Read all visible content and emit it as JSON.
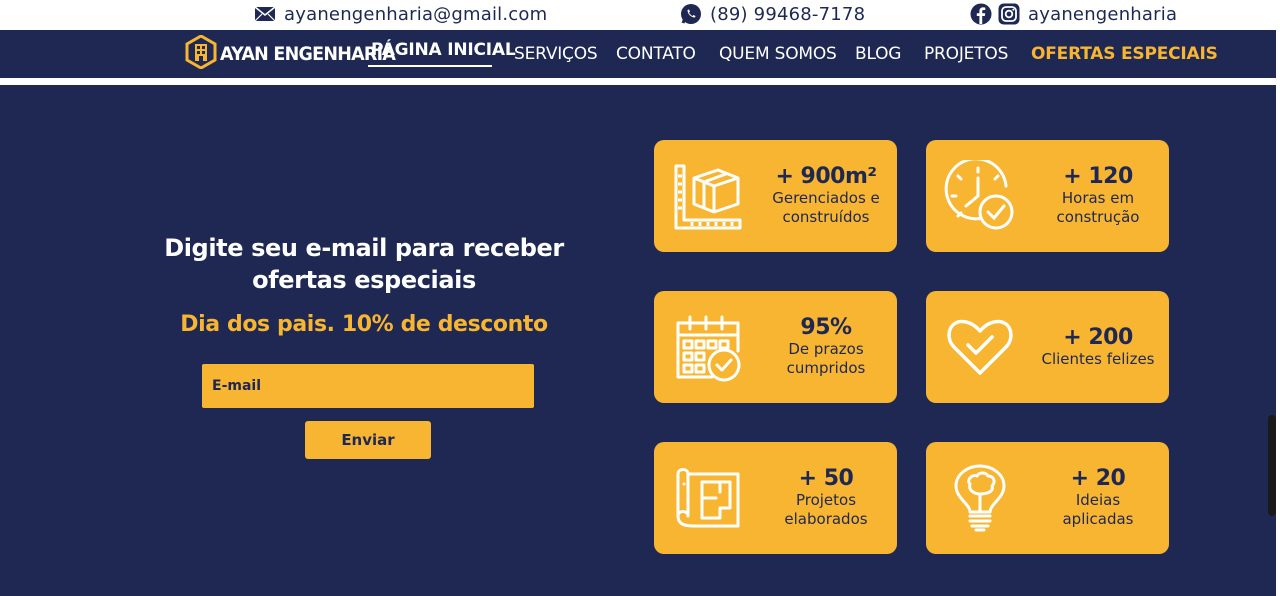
{
  "topbar": {
    "email": "ayanengenharia@gmail.com",
    "phone": "(89) 99468-7178",
    "social_handle": "ayanengenharia"
  },
  "nav": {
    "logo_text": "AYAN ENGENHARIA",
    "links": [
      {
        "label": "PÁGINA INICIAL",
        "active": true
      },
      {
        "label": "SERVIÇOS"
      },
      {
        "label": "CONTATO"
      },
      {
        "label": "QUEM SOMOS"
      },
      {
        "label": "BLOG"
      },
      {
        "label": "PROJETOS"
      },
      {
        "label": "OFERTAS ESPECIAIS",
        "highlight": true
      }
    ]
  },
  "signup": {
    "heading": "Digite seu e-mail para receber ofertas especiais",
    "promo": "Dia dos pais. 10% de desconto",
    "email_placeholder": "E-mail",
    "submit_label": "Enviar"
  },
  "stats": [
    {
      "icon": "cube-plan-icon",
      "value": "+ 900m²",
      "label": "Gerenciados e\nconstruídos"
    },
    {
      "icon": "clock-check-icon",
      "value": "+ 120",
      "label": "Horas em\nconstrução"
    },
    {
      "icon": "calendar-check-icon",
      "value": "95%",
      "label": "De prazos\ncumpridos"
    },
    {
      "icon": "heart-check-icon",
      "value": "+ 200",
      "label": "Clientes felizes"
    },
    {
      "icon": "blueprint-icon",
      "value": "+ 50",
      "label": "Projetos\nelaborados"
    },
    {
      "icon": "lightbulb-icon",
      "value": "+ 20",
      "label": "Ideias\naplicadas"
    }
  ],
  "colors": {
    "navy": "#1e2852",
    "accent": "#f8b531",
    "white": "#ffffff"
  }
}
